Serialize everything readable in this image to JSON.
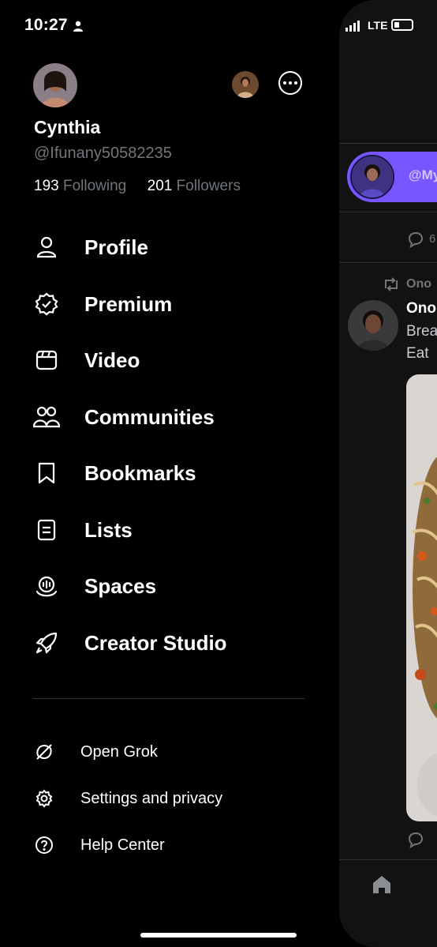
{
  "status_bar": {
    "time": "10:27",
    "network": "LTE"
  },
  "profile": {
    "name": "Cynthia",
    "handle": "@Ifunany50582235",
    "following_count": "193",
    "following_label": "Following",
    "followers_count": "201",
    "followers_label": "Followers"
  },
  "menu": [
    {
      "label": "Profile",
      "icon": "person-icon"
    },
    {
      "label": "Premium",
      "icon": "verified-badge-icon"
    },
    {
      "label": "Video",
      "icon": "video-icon"
    },
    {
      "label": "Communities",
      "icon": "communities-icon"
    },
    {
      "label": "Bookmarks",
      "icon": "bookmark-icon"
    },
    {
      "label": "Lists",
      "icon": "list-icon"
    },
    {
      "label": "Spaces",
      "icon": "spaces-icon"
    },
    {
      "label": "Creator Studio",
      "icon": "rocket-icon"
    }
  ],
  "secondary": [
    {
      "label": "Open Grok",
      "icon": "grok-icon"
    },
    {
      "label": "Settings and privacy",
      "icon": "gear-icon"
    },
    {
      "label": "Help Center",
      "icon": "help-icon"
    }
  ],
  "feed_peek": {
    "spaces_host": "@My",
    "reply_count": "6",
    "retweeted_by": "Ono",
    "author": "Ono",
    "text_line1": "Brea",
    "text_line2": "Eat"
  },
  "colors": {
    "background": "#000000",
    "accent_spaces": "#7856ff",
    "muted": "#71767b"
  }
}
